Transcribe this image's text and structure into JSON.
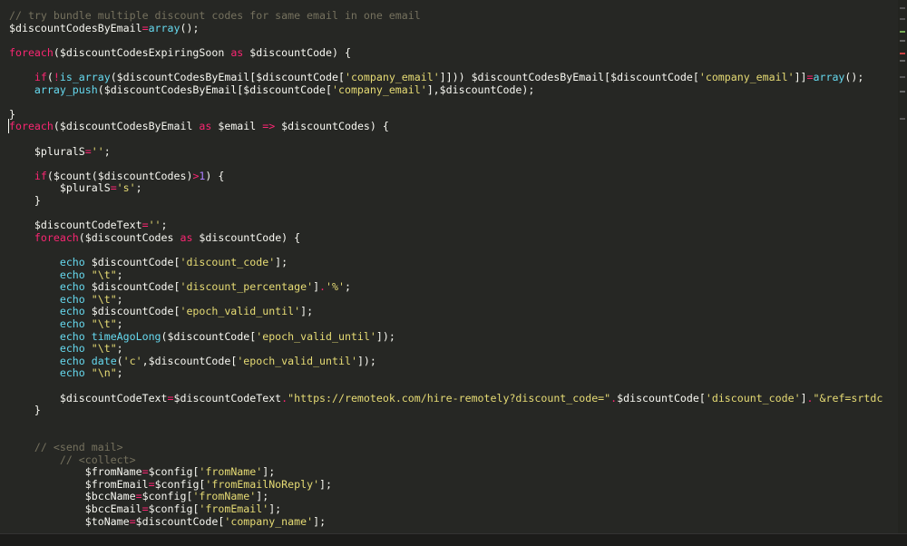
{
  "editor": {
    "lines": [
      {
        "indent": "",
        "segs": [
          {
            "c": "cmt",
            "t": "// try bundle multiple discount codes for same email in one email"
          }
        ]
      },
      {
        "indent": "",
        "segs": [
          {
            "c": "",
            "t": "$discountCodesByEmail"
          },
          {
            "c": "kw",
            "t": "="
          },
          {
            "c": "fn",
            "t": "array"
          },
          {
            "c": "",
            "t": "();"
          }
        ]
      },
      {
        "indent": "",
        "segs": []
      },
      {
        "indent": "",
        "segs": [
          {
            "c": "kw",
            "t": "foreach"
          },
          {
            "c": "",
            "t": "($discountCodesExpiringSoon "
          },
          {
            "c": "kw",
            "t": "as"
          },
          {
            "c": "",
            "t": " $discountCode) {"
          }
        ]
      },
      {
        "indent": "",
        "segs": []
      },
      {
        "indent": "    ",
        "segs": [
          {
            "c": "kw",
            "t": "if"
          },
          {
            "c": "",
            "t": "("
          },
          {
            "c": "kw",
            "t": "!"
          },
          {
            "c": "fn",
            "t": "is_array"
          },
          {
            "c": "",
            "t": "($discountCodesByEmail[$discountCode["
          },
          {
            "c": "str",
            "t": "'company_email'"
          },
          {
            "c": "",
            "t": "]])) $discountCodesByEmail[$discountCode["
          },
          {
            "c": "str",
            "t": "'company_email'"
          },
          {
            "c": "",
            "t": "]]"
          },
          {
            "c": "kw",
            "t": "="
          },
          {
            "c": "fn",
            "t": "array"
          },
          {
            "c": "",
            "t": "();"
          }
        ]
      },
      {
        "indent": "    ",
        "segs": [
          {
            "c": "fn",
            "t": "array_push"
          },
          {
            "c": "",
            "t": "($discountCodesByEmail[$discountCode["
          },
          {
            "c": "str",
            "t": "'company_email'"
          },
          {
            "c": "",
            "t": "],$discountCode);"
          }
        ]
      },
      {
        "indent": "",
        "segs": []
      },
      {
        "indent": "",
        "segs": [
          {
            "c": "",
            "t": "}"
          }
        ]
      },
      {
        "indent": "",
        "segs": [
          {
            "c": "kw",
            "t": "foreach"
          },
          {
            "c": "",
            "t": "($discountCodesByEmail "
          },
          {
            "c": "kw",
            "t": "as"
          },
          {
            "c": "",
            "t": " $email "
          },
          {
            "c": "kw",
            "t": "=>"
          },
          {
            "c": "",
            "t": " $discountCodes) {"
          }
        ]
      },
      {
        "indent": "",
        "segs": []
      },
      {
        "indent": "    ",
        "segs": [
          {
            "c": "",
            "t": "$pluralS"
          },
          {
            "c": "kw",
            "t": "="
          },
          {
            "c": "str",
            "t": "''"
          },
          {
            "c": "",
            "t": ";"
          }
        ]
      },
      {
        "indent": "",
        "segs": []
      },
      {
        "indent": "    ",
        "segs": [
          {
            "c": "kw",
            "t": "if"
          },
          {
            "c": "",
            "t": "($count($discountCodes)"
          },
          {
            "c": "kw",
            "t": ">"
          },
          {
            "c": "num",
            "t": "1"
          },
          {
            "c": "",
            "t": ") {"
          }
        ]
      },
      {
        "indent": "        ",
        "segs": [
          {
            "c": "",
            "t": "$pluralS"
          },
          {
            "c": "kw",
            "t": "="
          },
          {
            "c": "str",
            "t": "'s'"
          },
          {
            "c": "",
            "t": ";"
          }
        ]
      },
      {
        "indent": "    ",
        "segs": [
          {
            "c": "",
            "t": "}"
          }
        ]
      },
      {
        "indent": "",
        "segs": []
      },
      {
        "indent": "    ",
        "segs": [
          {
            "c": "",
            "t": "$discountCodeText"
          },
          {
            "c": "kw",
            "t": "="
          },
          {
            "c": "str",
            "t": "''"
          },
          {
            "c": "",
            "t": ";"
          }
        ]
      },
      {
        "indent": "    ",
        "segs": [
          {
            "c": "kw",
            "t": "foreach"
          },
          {
            "c": "",
            "t": "($discountCodes "
          },
          {
            "c": "kw",
            "t": "as"
          },
          {
            "c": "",
            "t": " $discountCode) {"
          }
        ]
      },
      {
        "indent": "",
        "segs": []
      },
      {
        "indent": "        ",
        "segs": [
          {
            "c": "fn",
            "t": "echo"
          },
          {
            "c": "",
            "t": " $discountCode["
          },
          {
            "c": "str",
            "t": "'discount_code'"
          },
          {
            "c": "",
            "t": "];"
          }
        ]
      },
      {
        "indent": "        ",
        "segs": [
          {
            "c": "fn",
            "t": "echo"
          },
          {
            "c": "",
            "t": " "
          },
          {
            "c": "str",
            "t": "\"\\t\""
          },
          {
            "c": "",
            "t": ";"
          }
        ]
      },
      {
        "indent": "        ",
        "segs": [
          {
            "c": "fn",
            "t": "echo"
          },
          {
            "c": "",
            "t": " $discountCode["
          },
          {
            "c": "str",
            "t": "'discount_percentage'"
          },
          {
            "c": "",
            "t": "]"
          },
          {
            "c": "kw",
            "t": "."
          },
          {
            "c": "str",
            "t": "'%'"
          },
          {
            "c": "",
            "t": ";"
          }
        ]
      },
      {
        "indent": "        ",
        "segs": [
          {
            "c": "fn",
            "t": "echo"
          },
          {
            "c": "",
            "t": " "
          },
          {
            "c": "str",
            "t": "\"\\t\""
          },
          {
            "c": "",
            "t": ";"
          }
        ]
      },
      {
        "indent": "        ",
        "segs": [
          {
            "c": "fn",
            "t": "echo"
          },
          {
            "c": "",
            "t": " $discountCode["
          },
          {
            "c": "str",
            "t": "'epoch_valid_until'"
          },
          {
            "c": "",
            "t": "];"
          }
        ]
      },
      {
        "indent": "        ",
        "segs": [
          {
            "c": "fn",
            "t": "echo"
          },
          {
            "c": "",
            "t": " "
          },
          {
            "c": "str",
            "t": "\"\\t\""
          },
          {
            "c": "",
            "t": ";"
          }
        ]
      },
      {
        "indent": "        ",
        "segs": [
          {
            "c": "fn",
            "t": "echo"
          },
          {
            "c": "",
            "t": " "
          },
          {
            "c": "fn",
            "t": "timeAgoLong"
          },
          {
            "c": "",
            "t": "($discountCode["
          },
          {
            "c": "str",
            "t": "'epoch_valid_until'"
          },
          {
            "c": "",
            "t": "]);"
          }
        ]
      },
      {
        "indent": "        ",
        "segs": [
          {
            "c": "fn",
            "t": "echo"
          },
          {
            "c": "",
            "t": " "
          },
          {
            "c": "str",
            "t": "\"\\t\""
          },
          {
            "c": "",
            "t": ";"
          }
        ]
      },
      {
        "indent": "        ",
        "segs": [
          {
            "c": "fn",
            "t": "echo"
          },
          {
            "c": "",
            "t": " "
          },
          {
            "c": "fn",
            "t": "date"
          },
          {
            "c": "",
            "t": "("
          },
          {
            "c": "str",
            "t": "'c'"
          },
          {
            "c": "",
            "t": ",$discountCode["
          },
          {
            "c": "str",
            "t": "'epoch_valid_until'"
          },
          {
            "c": "",
            "t": "]);"
          }
        ]
      },
      {
        "indent": "        ",
        "segs": [
          {
            "c": "fn",
            "t": "echo"
          },
          {
            "c": "",
            "t": " "
          },
          {
            "c": "str",
            "t": "\"\\n\""
          },
          {
            "c": "",
            "t": ";"
          }
        ]
      },
      {
        "indent": "",
        "segs": []
      },
      {
        "indent": "        ",
        "segs": [
          {
            "c": "",
            "t": "$discountCodeText"
          },
          {
            "c": "kw",
            "t": "="
          },
          {
            "c": "",
            "t": "$discountCodeText"
          },
          {
            "c": "kw",
            "t": "."
          },
          {
            "c": "str",
            "t": "\"https://remoteok.com/hire-remotely?discount_code=\""
          },
          {
            "c": "kw",
            "t": "."
          },
          {
            "c": "",
            "t": "$discountCode["
          },
          {
            "c": "str",
            "t": "'discount_code'"
          },
          {
            "c": "",
            "t": "]"
          },
          {
            "c": "kw",
            "t": "."
          },
          {
            "c": "str",
            "t": "\"&ref=srtdc"
          }
        ]
      },
      {
        "indent": "    ",
        "segs": [
          {
            "c": "",
            "t": "}"
          }
        ]
      },
      {
        "indent": "",
        "segs": []
      },
      {
        "indent": "",
        "segs": []
      },
      {
        "indent": "    ",
        "segs": [
          {
            "c": "cmt",
            "t": "// <send mail>"
          }
        ]
      },
      {
        "indent": "        ",
        "segs": [
          {
            "c": "cmt",
            "t": "// <collect>"
          }
        ]
      },
      {
        "indent": "            ",
        "segs": [
          {
            "c": "",
            "t": "$fromName"
          },
          {
            "c": "kw",
            "t": "="
          },
          {
            "c": "",
            "t": "$config["
          },
          {
            "c": "str",
            "t": "'fromName'"
          },
          {
            "c": "",
            "t": "];"
          }
        ]
      },
      {
        "indent": "            ",
        "segs": [
          {
            "c": "",
            "t": "$fromEmail"
          },
          {
            "c": "kw",
            "t": "="
          },
          {
            "c": "",
            "t": "$config["
          },
          {
            "c": "str",
            "t": "'fromEmailNoReply'"
          },
          {
            "c": "",
            "t": "];"
          }
        ]
      },
      {
        "indent": "            ",
        "segs": [
          {
            "c": "",
            "t": "$bccName"
          },
          {
            "c": "kw",
            "t": "="
          },
          {
            "c": "",
            "t": "$config["
          },
          {
            "c": "str",
            "t": "'fromName'"
          },
          {
            "c": "",
            "t": "];"
          }
        ]
      },
      {
        "indent": "            ",
        "segs": [
          {
            "c": "",
            "t": "$bccEmail"
          },
          {
            "c": "kw",
            "t": "="
          },
          {
            "c": "",
            "t": "$config["
          },
          {
            "c": "str",
            "t": "'fromEmail'"
          },
          {
            "c": "",
            "t": "];"
          }
        ]
      },
      {
        "indent": "            ",
        "segs": [
          {
            "c": "",
            "t": "$toName"
          },
          {
            "c": "kw",
            "t": "="
          },
          {
            "c": "",
            "t": "$discountCode["
          },
          {
            "c": "str",
            "t": "'company_name'"
          },
          {
            "c": "",
            "t": "];"
          }
        ]
      }
    ]
  }
}
